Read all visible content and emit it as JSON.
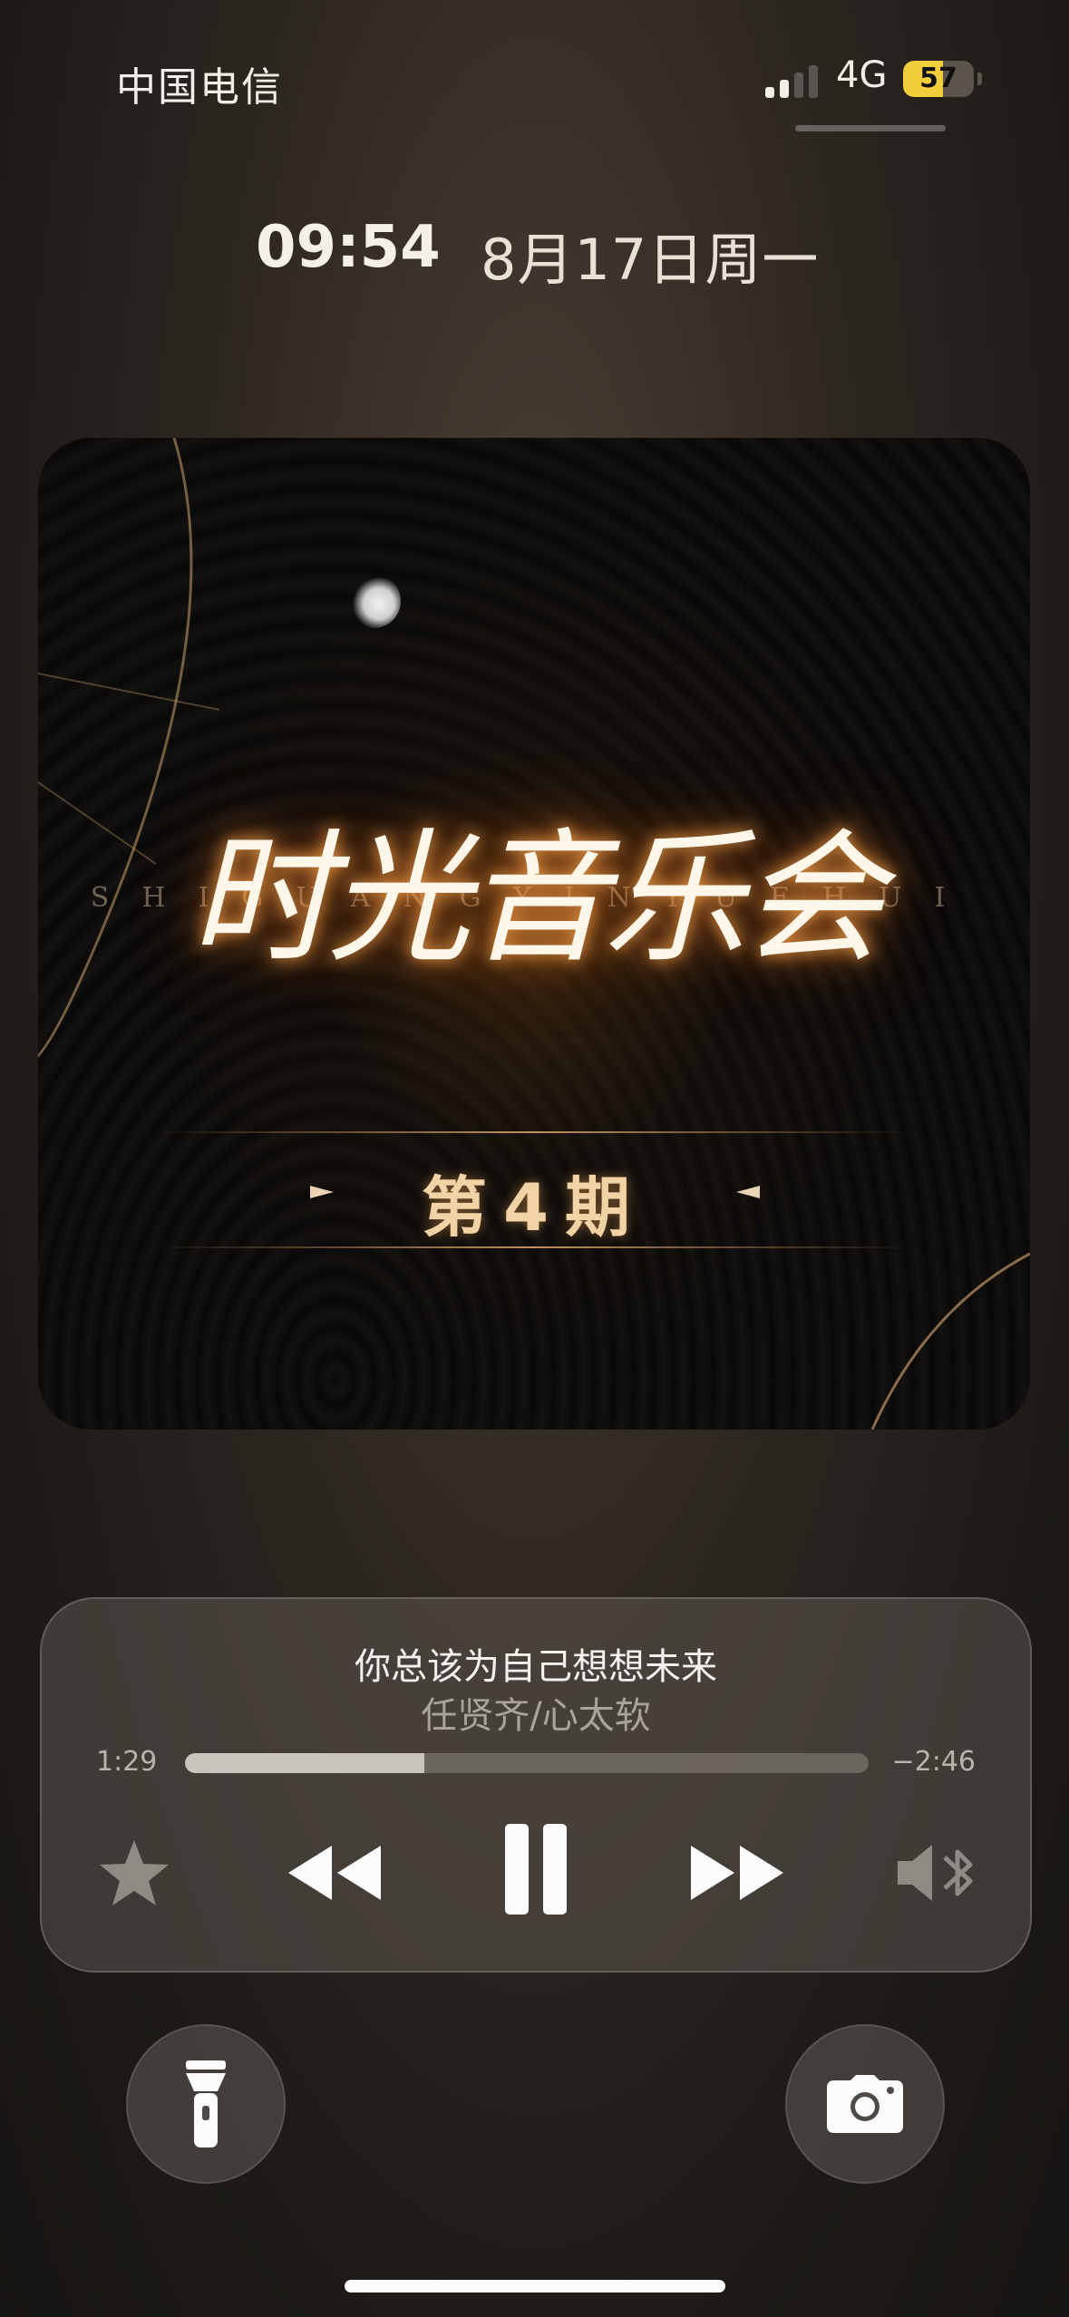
{
  "status_bar": {
    "carrier": "中国电信",
    "network": "4G",
    "battery_level": "57",
    "signal_bars_active": 2,
    "signal_bars_total": 4
  },
  "lock_clock": {
    "time": "09:54",
    "date": "8月17日周一"
  },
  "album_art": {
    "title": "时光音乐会",
    "pinyin": "SHIGUANGYINYUEHUI",
    "episode": "第4期"
  },
  "now_playing": {
    "title": "你总该为自己想想未来",
    "artist": "任贤齐/心太软",
    "elapsed": "1:29",
    "remaining": "−2:46",
    "progress_fraction": 0.35
  },
  "controls": {
    "favorite_icon": "star-icon",
    "previous_icon": "rewind-icon",
    "play_pause_icon": "pause-icon",
    "next_icon": "fast-forward-icon",
    "audio_output_icon": "speaker-bluetooth-icon"
  },
  "shortcuts": {
    "left_icon": "flashlight-icon",
    "right_icon": "camera-icon"
  },
  "colors": {
    "battery_fill": "#f2cd3c",
    "title_glow": "#ffaa50",
    "episode_text": "#f2d3a6"
  }
}
